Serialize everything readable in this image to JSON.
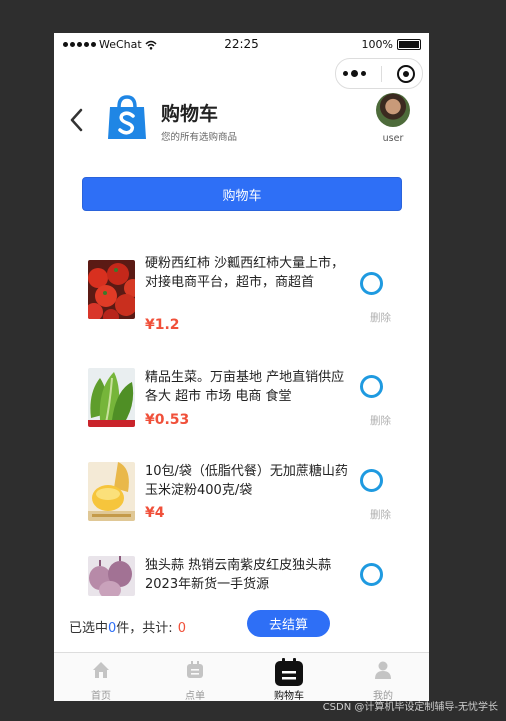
{
  "status_bar": {
    "carrier": "WeChat",
    "time": "22:25",
    "battery": "100%"
  },
  "header": {
    "title": "购物车",
    "subtitle": "您的所有选购商品",
    "user_label": "user"
  },
  "cart_button_label": "购物车",
  "items": [
    {
      "name": "硬粉西红柿 沙瓤西红柿大量上市，对接电商平台，超市，商超首",
      "price": "¥1.2",
      "delete_label": "删除"
    },
    {
      "name": "精品生菜。万亩基地 产地直销供应各大 超市 市场 电商 食堂",
      "price": "¥0.53",
      "delete_label": "删除"
    },
    {
      "name": "10包/袋（低脂代餐）无加蔗糖山药玉米淀粉400克/袋",
      "price": "¥4",
      "delete_label": "删除"
    },
    {
      "name": "独头蒜 热销云南紫皮红皮独头蒜2023年新货一手货源",
      "price": "",
      "delete_label": ""
    }
  ],
  "footer": {
    "selected_prefix": "已选中",
    "selected_count": "0",
    "selected_suffix": "件，共计:",
    "total": "0",
    "checkout_label": "去结算"
  },
  "tabs": [
    {
      "label": "首页",
      "icon": "home-icon"
    },
    {
      "label": "点单",
      "icon": "order-icon"
    },
    {
      "label": "购物车",
      "icon": "cart-icon"
    },
    {
      "label": "我的",
      "icon": "profile-icon"
    }
  ],
  "watermark": "CSDN @计算机毕设定制辅导-无忧学长",
  "colors": {
    "accent": "#2e6ff6",
    "price": "#f0503a",
    "check": "#1f9ae0"
  }
}
